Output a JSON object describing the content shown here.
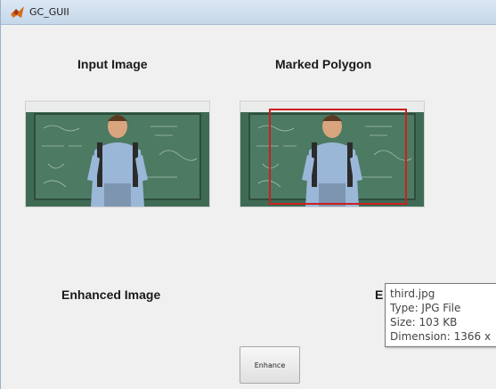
{
  "window": {
    "title": "GC_GUII"
  },
  "panels": {
    "input_title": "Input Image",
    "marked_title": "Marked Polygon",
    "enhanced_title": "Enhanced Image",
    "partial_title_letter": "E"
  },
  "buttons": {
    "enhance_label": "Enhance"
  },
  "tooltip": {
    "name": "third.jpg",
    "type": "Type: JPG File",
    "size": "Size: 103 KB",
    "dimension": "Dimension: 1366 x"
  },
  "colors": {
    "polygon_outline": "#cc1f1f",
    "chalkboard": "#3f6b55",
    "shirt": "#9ab7d8"
  }
}
